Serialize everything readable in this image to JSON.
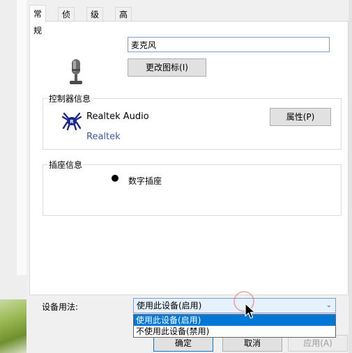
{
  "tabs": [
    {
      "label": "常规",
      "active": true
    },
    {
      "label": "侦听",
      "active": false
    },
    {
      "label": "级别",
      "active": false
    },
    {
      "label": "高级",
      "active": false
    }
  ],
  "device": {
    "icon": "microphone-icon",
    "name_value": "麦克风",
    "change_icon_label": "更改图标(I)"
  },
  "controller": {
    "group_title": "控制器信息",
    "logo_icon": "realtek-crab-icon",
    "name": "Realtek Audio",
    "vendor": "Realtek",
    "properties_label": "属性(P)"
  },
  "jack": {
    "group_title": "插座信息",
    "label": "数字插座"
  },
  "usage": {
    "label": "设备用法:",
    "selected": "使用此设备(启用)",
    "options": [
      "使用此设备(启用)",
      "不使用此设备(禁用)"
    ]
  },
  "buttons": {
    "ok": "确定",
    "cancel": "取消",
    "apply": "应用(A)"
  },
  "colors": {
    "accent": "#0078d7",
    "vendor_link": "#3a5ba0"
  }
}
